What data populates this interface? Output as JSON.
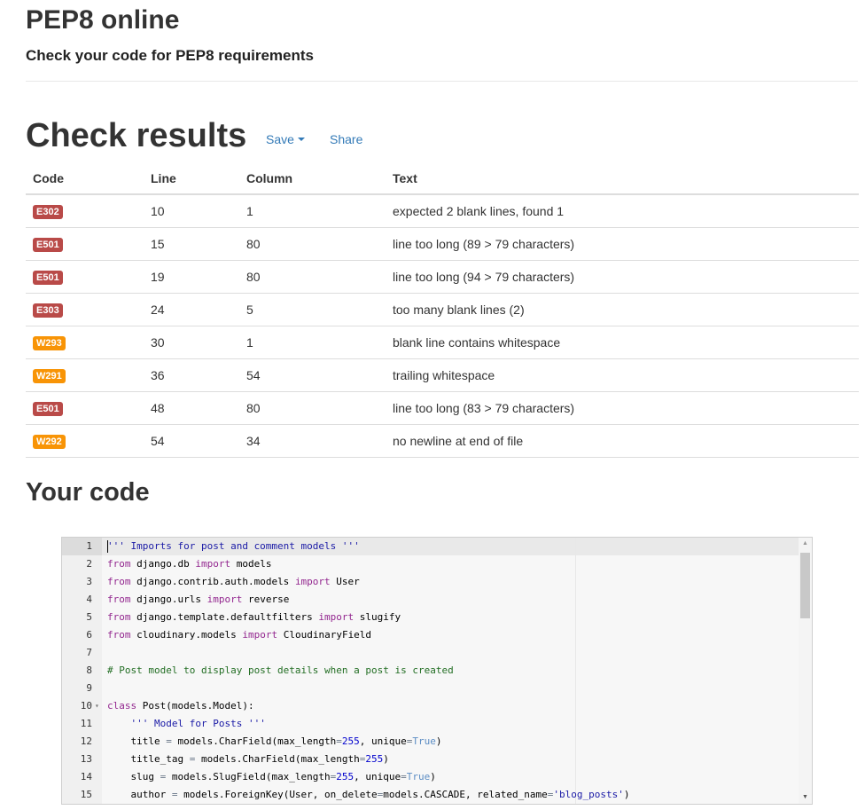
{
  "header": {
    "title": "PEP8 online",
    "subtitle": "Check your code for PEP8 requirements"
  },
  "results": {
    "title": "Check results",
    "save_label": "Save",
    "share_label": "Share",
    "columns": [
      "Code",
      "Line",
      "Column",
      "Text"
    ],
    "rows": [
      {
        "code": "E302",
        "level": "error",
        "line": "10",
        "column": "1",
        "text": "expected 2 blank lines, found 1"
      },
      {
        "code": "E501",
        "level": "error",
        "line": "15",
        "column": "80",
        "text": "line too long (89 > 79 characters)"
      },
      {
        "code": "E501",
        "level": "error",
        "line": "19",
        "column": "80",
        "text": "line too long (94 > 79 characters)"
      },
      {
        "code": "E303",
        "level": "error",
        "line": "24",
        "column": "5",
        "text": "too many blank lines (2)"
      },
      {
        "code": "W293",
        "level": "warning",
        "line": "30",
        "column": "1",
        "text": "blank line contains whitespace"
      },
      {
        "code": "W291",
        "level": "warning",
        "line": "36",
        "column": "54",
        "text": "trailing whitespace"
      },
      {
        "code": "E501",
        "level": "error",
        "line": "48",
        "column": "80",
        "text": "line too long (83 > 79 characters)"
      },
      {
        "code": "W292",
        "level": "warning",
        "line": "54",
        "column": "34",
        "text": "no newline at end of file"
      }
    ]
  },
  "code": {
    "title": "Your code",
    "lines": [
      {
        "num": "1",
        "fold": false,
        "tokens": [
          [
            "str",
            "''' Imports for post and comment models '''"
          ]
        ]
      },
      {
        "num": "2",
        "fold": false,
        "tokens": [
          [
            "kw",
            "from"
          ],
          [
            "plain",
            " django.db "
          ],
          [
            "kw",
            "import"
          ],
          [
            "plain",
            " models"
          ]
        ]
      },
      {
        "num": "3",
        "fold": false,
        "tokens": [
          [
            "kw",
            "from"
          ],
          [
            "plain",
            " django.contrib.auth.models "
          ],
          [
            "kw",
            "import"
          ],
          [
            "plain",
            " User"
          ]
        ]
      },
      {
        "num": "4",
        "fold": false,
        "tokens": [
          [
            "kw",
            "from"
          ],
          [
            "plain",
            " django.urls "
          ],
          [
            "kw",
            "import"
          ],
          [
            "plain",
            " reverse"
          ]
        ]
      },
      {
        "num": "5",
        "fold": false,
        "tokens": [
          [
            "kw",
            "from"
          ],
          [
            "plain",
            " django.template.defaultfilters "
          ],
          [
            "kw",
            "import"
          ],
          [
            "plain",
            " slugify"
          ]
        ]
      },
      {
        "num": "6",
        "fold": false,
        "tokens": [
          [
            "kw",
            "from"
          ],
          [
            "plain",
            " cloudinary.models "
          ],
          [
            "kw",
            "import"
          ],
          [
            "plain",
            " CloudinaryField"
          ]
        ]
      },
      {
        "num": "7",
        "fold": false,
        "tokens": []
      },
      {
        "num": "8",
        "fold": false,
        "tokens": [
          [
            "comment",
            "# Post model to display post details when a post is created"
          ]
        ]
      },
      {
        "num": "9",
        "fold": false,
        "tokens": []
      },
      {
        "num": "10",
        "fold": true,
        "tokens": [
          [
            "kw",
            "class"
          ],
          [
            "plain",
            " Post(models.Model):"
          ]
        ]
      },
      {
        "num": "11",
        "fold": false,
        "tokens": [
          [
            "plain",
            "    "
          ],
          [
            "str",
            "''' Model for Posts '''"
          ]
        ]
      },
      {
        "num": "12",
        "fold": false,
        "tokens": [
          [
            "plain",
            "    title "
          ],
          [
            "op",
            "="
          ],
          [
            "plain",
            " models.CharField(max_length"
          ],
          [
            "op",
            "="
          ],
          [
            "num",
            "255"
          ],
          [
            "plain",
            ", unique"
          ],
          [
            "op",
            "="
          ],
          [
            "const",
            "True"
          ],
          [
            "plain",
            ")"
          ]
        ]
      },
      {
        "num": "13",
        "fold": false,
        "tokens": [
          [
            "plain",
            "    title_tag "
          ],
          [
            "op",
            "="
          ],
          [
            "plain",
            " models.CharField(max_length"
          ],
          [
            "op",
            "="
          ],
          [
            "num",
            "255"
          ],
          [
            "plain",
            ")"
          ]
        ]
      },
      {
        "num": "14",
        "fold": false,
        "tokens": [
          [
            "plain",
            "    slug "
          ],
          [
            "op",
            "="
          ],
          [
            "plain",
            " models.SlugField(max_length"
          ],
          [
            "op",
            "="
          ],
          [
            "num",
            "255"
          ],
          [
            "plain",
            ", unique"
          ],
          [
            "op",
            "="
          ],
          [
            "const",
            "True"
          ],
          [
            "plain",
            ")"
          ]
        ]
      },
      {
        "num": "15",
        "fold": false,
        "tokens": [
          [
            "plain",
            "    author "
          ],
          [
            "op",
            "="
          ],
          [
            "plain",
            " models.ForeignKey(User, on_delete"
          ],
          [
            "op",
            "="
          ],
          [
            "plain",
            "models.CASCADE, related_name"
          ],
          [
            "op",
            "="
          ],
          [
            "str",
            "'blog_posts'"
          ],
          [
            "plain",
            ")"
          ]
        ]
      }
    ]
  },
  "colors": {
    "error_badge": "#b94a48",
    "warning_badge": "#f89406",
    "link": "#337ab7",
    "keyword": "#93278f",
    "string": "#1a1aa6",
    "comment": "#236e24",
    "number": "#0000cd",
    "constant": "#5c8dc4",
    "operator": "#687687"
  },
  "icons": {
    "save_caret": "caret-down-icon",
    "fold": "fold-arrow-icon",
    "scroll_up": "scroll-up-icon",
    "scroll_down": "scroll-down-icon"
  }
}
